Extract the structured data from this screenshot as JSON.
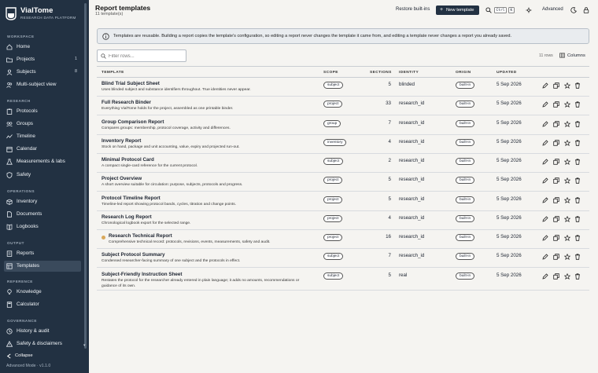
{
  "brand": {
    "name": "VialTome",
    "subtitle": "RESEARCH DATA PLATFORM"
  },
  "sidebar": {
    "sections": [
      {
        "title": "WORKSPACE",
        "items": [
          {
            "label": "Home",
            "icon": "home-icon"
          },
          {
            "label": "Projects",
            "icon": "folder-icon",
            "count": "1"
          },
          {
            "label": "Subjects",
            "icon": "user-icon",
            "count": "8"
          },
          {
            "label": "Multi-subject view",
            "icon": "users-icon"
          }
        ]
      },
      {
        "title": "RESEARCH",
        "items": [
          {
            "label": "Protocols",
            "icon": "clipboard-icon"
          },
          {
            "label": "Groups",
            "icon": "group-icon"
          },
          {
            "label": "Timeline",
            "icon": "timeline-icon"
          },
          {
            "label": "Calendar",
            "icon": "calendar-icon"
          },
          {
            "label": "Measurements & labs",
            "icon": "flask-icon"
          },
          {
            "label": "Safety",
            "icon": "shield-icon"
          }
        ]
      },
      {
        "title": "OPERATIONS",
        "items": [
          {
            "label": "Inventory",
            "icon": "box-icon"
          },
          {
            "label": "Documents",
            "icon": "document-icon"
          },
          {
            "label": "Logbooks",
            "icon": "book-icon"
          }
        ]
      },
      {
        "title": "OUTPUT",
        "items": [
          {
            "label": "Reports",
            "icon": "report-icon"
          },
          {
            "label": "Templates",
            "icon": "template-icon",
            "active": true
          }
        ]
      },
      {
        "title": "REFERENCE",
        "items": [
          {
            "label": "Knowledge",
            "icon": "bulb-icon"
          },
          {
            "label": "Calculator",
            "icon": "calculator-icon"
          }
        ]
      },
      {
        "title": "GOVERNANCE",
        "items": [
          {
            "label": "History & audit",
            "icon": "history-icon"
          },
          {
            "label": "Safety & disclaimers",
            "icon": "warning-icon"
          }
        ]
      }
    ],
    "collapse_label": "Collapse",
    "mode_label": "Advanced Mode · v1.1.0"
  },
  "header": {
    "title": "Report templates",
    "subtitle": "11 template(s)",
    "restore_label": "Restore built-ins",
    "new_label": "New template",
    "kbd_ctrl": "Ctrl",
    "kbd_k": "K",
    "advanced_label": "Advanced"
  },
  "banner": {
    "text": "Templates are reusable. Building a report copies the template's configuration, so editing a report never changes the template it came from, and editing a template never changes a report you already saved."
  },
  "filter": {
    "placeholder": "Filter rows...",
    "rows_count": "11 rows",
    "columns_label": "Columns"
  },
  "table": {
    "headers": {
      "template": "TEMPLATE",
      "scope": "SCOPE",
      "sections": "SECTIONS",
      "identity": "IDENTITY",
      "origin": "ORIGIN",
      "updated": "UPDATED"
    },
    "rows": [
      {
        "name": "Blind Trial Subject Sheet",
        "desc": "Uses blinded subject and substance identifiers throughout. True identities never appear.",
        "scope": "subject",
        "sections": "5",
        "identity": "blinded",
        "origin": "built-in",
        "updated": "5 Sep 2026"
      },
      {
        "name": "Full Research Binder",
        "desc": "Everything VialTome holds for the project, assembled as one printable binder.",
        "scope": "project",
        "sections": "33",
        "identity": "research_id",
        "origin": "built-in",
        "updated": "5 Sep 2026"
      },
      {
        "name": "Group Comparison Report",
        "desc": "Compares groups: membership, protocol coverage, activity and differences.",
        "scope": "group",
        "sections": "7",
        "identity": "research_id",
        "origin": "built-in",
        "updated": "5 Sep 2026"
      },
      {
        "name": "Inventory Report",
        "desc": "Stock on hand, package and unit accounting, value, expiry and projected run-out.",
        "scope": "inventory",
        "sections": "4",
        "identity": "research_id",
        "origin": "built-in",
        "updated": "5 Sep 2026"
      },
      {
        "name": "Minimal Protocol Card",
        "desc": "A compact single-card reference for the current protocol.",
        "scope": "subject",
        "sections": "2",
        "identity": "research_id",
        "origin": "built-in",
        "updated": "5 Sep 2026"
      },
      {
        "name": "Project Overview",
        "desc": "A short overview suitable for circulation: purpose, subjects, protocols and progress.",
        "scope": "project",
        "sections": "5",
        "identity": "research_id",
        "origin": "built-in",
        "updated": "5 Sep 2026"
      },
      {
        "name": "Protocol Timeline Report",
        "desc": "Timeline-led report showing protocol bands, cycles, titration and change points.",
        "scope": "project",
        "sections": "5",
        "identity": "research_id",
        "origin": "built-in",
        "updated": "5 Sep 2026"
      },
      {
        "name": "Research Log Report",
        "desc": "Chronological logbook export for the selected range.",
        "scope": "project",
        "sections": "4",
        "identity": "research_id",
        "origin": "built-in",
        "updated": "5 Sep 2026"
      },
      {
        "name": "Research Technical Report",
        "desc": "Comprehensive technical record: protocols, revisions, events, measurements, safety and audit.",
        "scope": "project",
        "sections": "16",
        "identity": "research_id",
        "origin": "built-in",
        "updated": "5 Sep 2026",
        "starred": true
      },
      {
        "name": "Subject Protocol Summary",
        "desc": "Condensed researcher-facing summary of one subject and the protocols in effect.",
        "scope": "subject",
        "sections": "7",
        "identity": "research_id",
        "origin": "built-in",
        "updated": "5 Sep 2026"
      },
      {
        "name": "Subject-Friendly Instruction Sheet",
        "desc": "Restates the protocol for the researcher already entered in plain language; it adds no amounts, recommendations or guidance of its own.",
        "scope": "subject",
        "sections": "5",
        "identity": "real",
        "origin": "built-in",
        "updated": "5 Sep 2026",
        "wrap": true
      }
    ]
  },
  "colors": {
    "sidebar_bg": "#223142",
    "accent": "#223142",
    "starred_dot": "#d9a85a"
  }
}
